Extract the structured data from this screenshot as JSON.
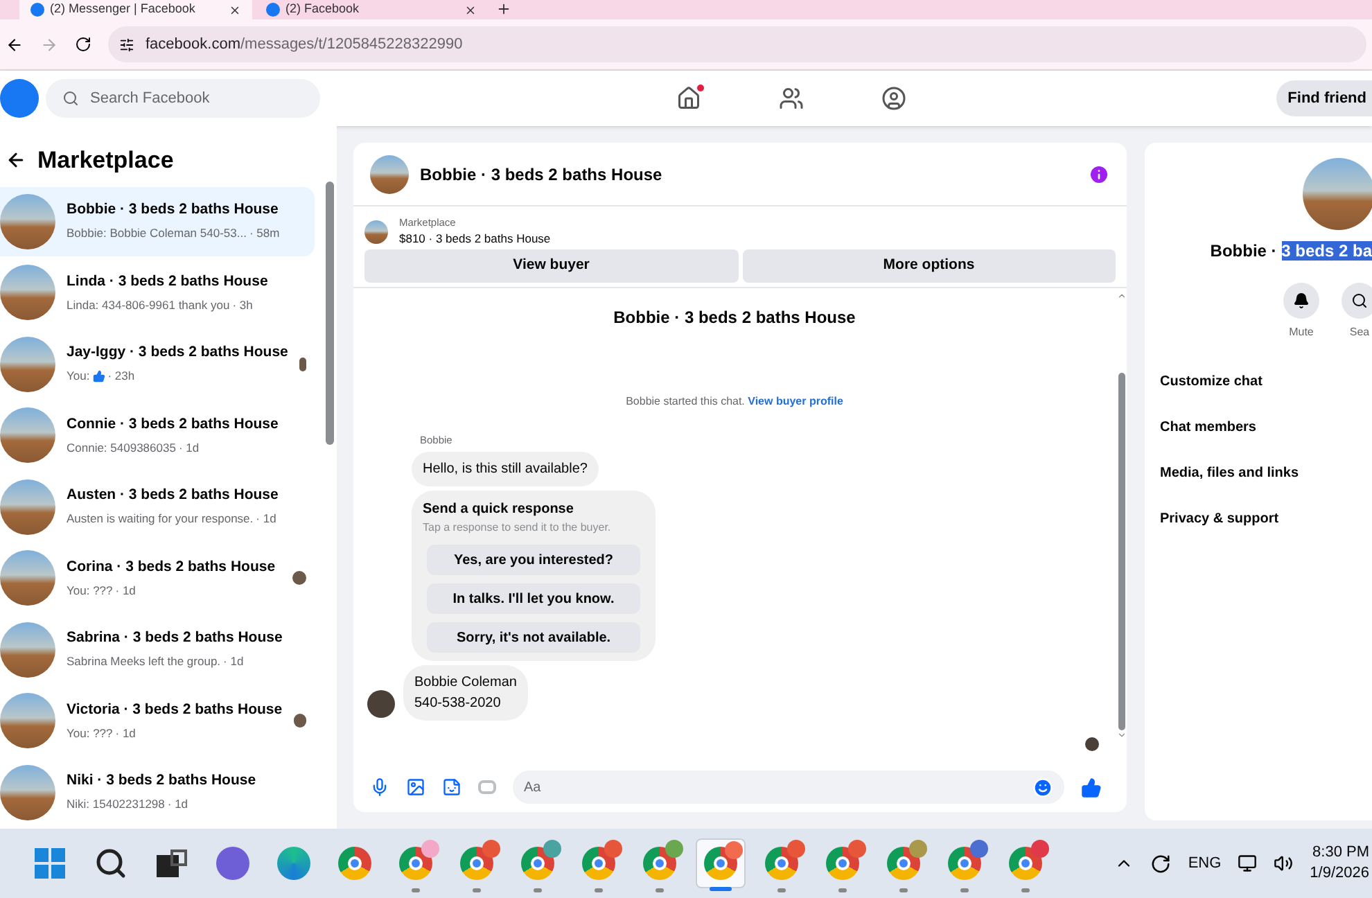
{
  "browser_tabs": [
    {
      "title": "(2) Messenger | Facebook",
      "selected": true
    },
    {
      "title": "(2) Facebook",
      "selected": false
    }
  ],
  "address_bar": {
    "url_host": "facebook.com",
    "url_path": "/messages/t/1205845228322990"
  },
  "header": {
    "search_placeholder": "Search Facebook",
    "home_notification": true,
    "find_friends": "Find friend"
  },
  "sidebar": {
    "title": "Marketplace",
    "items": [
      {
        "name": "Bobbie · 3 beds 2 baths House",
        "preview": "Bobbie: Bobbie Coleman 540-53...",
        "time": "· 58m",
        "like_icon": false,
        "seen_avatar": false,
        "selected": true
      },
      {
        "name": "Linda · 3 beds 2 baths House",
        "preview": "Linda: 434-806-9961 thank you",
        "time": "· 3h",
        "like_icon": false,
        "seen_avatar": false,
        "selected": false
      },
      {
        "name": "Jay-Iggy · 3 beds 2 baths House",
        "preview": "You:",
        "time": "· 23h",
        "like_icon": true,
        "seen_avatar": true,
        "selected": false
      },
      {
        "name": "Connie · 3 beds 2 baths House",
        "preview": "Connie: 5409386035",
        "time": "· 1d",
        "like_icon": false,
        "seen_avatar": false,
        "selected": false
      },
      {
        "name": "Austen · 3 beds 2 baths House",
        "preview": "Austen is waiting for your response.",
        "time": "· 1d",
        "like_icon": false,
        "seen_avatar": false,
        "selected": false
      },
      {
        "name": "Corina · 3 beds 2 baths House",
        "preview": "You: ???",
        "time": "· 1d",
        "like_icon": false,
        "seen_avatar": true,
        "selected": false
      },
      {
        "name": "Sabrina · 3 beds 2 baths House",
        "preview": "Sabrina Meeks left the group.",
        "time": "· 1d",
        "like_icon": false,
        "seen_avatar": false,
        "selected": false
      },
      {
        "name": "Victoria · 3 beds 2 baths House",
        "preview": "You: ???",
        "time": "· 1d",
        "like_icon": false,
        "seen_avatar": true,
        "selected": false
      },
      {
        "name": "Niki · 3 beds 2 baths House",
        "preview": "Niki: 15402231298",
        "time": "· 1d",
        "like_icon": false,
        "seen_avatar": false,
        "selected": false
      }
    ]
  },
  "chat": {
    "title": "Bobbie · 3 beds 2 baths House",
    "listing_label": "Marketplace",
    "listing": "$810 · 3 beds 2 baths House",
    "buttons": [
      "View buyer",
      "More options"
    ],
    "intro_name": "Bobbie · 3 beds 2 baths House",
    "started": "Bobbie started this chat.",
    "profile_link": "View buyer profile",
    "sender": "Bobbie",
    "message": "Hello, is this still available?",
    "quick": {
      "title": "Send a quick response",
      "hint": "Tap a response to send it to the buyer.",
      "options": [
        "Yes, are you interested?",
        "In talks. I'll let you know.",
        "Sorry, it's not available."
      ]
    },
    "contact_lines": [
      "Bobbie Coleman",
      "540-538-2020"
    ],
    "composer_placeholder": "Aa"
  },
  "details": {
    "name": "Bobbie · ",
    "name_selected": "3 beds 2 ba",
    "actions": [
      "Mute",
      "Sea"
    ],
    "menu": [
      "Customize chat",
      "Chat members",
      "Media, files and links",
      "Privacy & support"
    ]
  },
  "taskbar": {
    "apps": [
      {
        "kind": "start"
      },
      {
        "kind": "search"
      },
      {
        "kind": "taskview"
      },
      {
        "kind": "meet"
      },
      {
        "kind": "edge"
      },
      {
        "kind": "chrome"
      },
      {
        "kind": "profile",
        "color": "#f4a8c8",
        "selected": false
      },
      {
        "kind": "profile",
        "color": "#e8563a",
        "selected": false
      },
      {
        "kind": "profile",
        "color": "#4aa3a0",
        "selected": false
      },
      {
        "kind": "profile",
        "color": "#e8563a",
        "selected": false
      },
      {
        "kind": "profile",
        "color": "#6aa84f",
        "selected": false
      },
      {
        "kind": "profile",
        "color": "#f26b4f",
        "selected": true
      },
      {
        "kind": "profile",
        "color": "#e8563a",
        "selected": false
      },
      {
        "kind": "profile",
        "color": "#e8563a",
        "selected": false
      },
      {
        "kind": "profile",
        "color": "#a89a4a",
        "selected": false
      },
      {
        "kind": "profile",
        "color": "#4a6fd1",
        "selected": false
      },
      {
        "kind": "profile",
        "color": "#e03a4a",
        "selected": false
      }
    ],
    "language": "ENG",
    "time": "8:30 PM",
    "date": "1/9/2026"
  }
}
